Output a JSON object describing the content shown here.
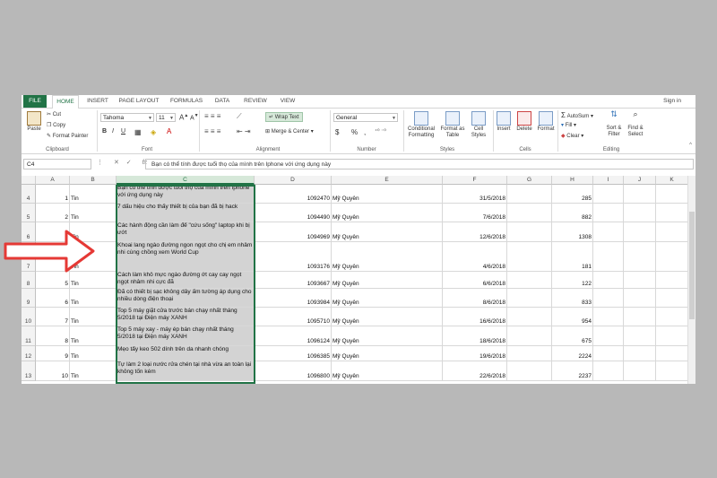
{
  "tabs": [
    "FILE",
    "HOME",
    "INSERT",
    "PAGE LAYOUT",
    "FORMULAS",
    "DATA",
    "REVIEW",
    "VIEW"
  ],
  "sign_in": "Sign in",
  "clipboard": {
    "cut": "Cut",
    "copy": "Copy",
    "paste": "Paste",
    "format_painter": "Format Painter",
    "label": "Clipboard"
  },
  "font": {
    "name": "Tahoma",
    "size": "11",
    "label": "Font",
    "bold": "B",
    "italic": "I",
    "underline": "U"
  },
  "alignment": {
    "wrap_text": "Wrap Text",
    "merge_center": "Merge & Center",
    "label": "Alignment"
  },
  "number": {
    "format": "General",
    "currency": "$",
    "percent": "%",
    "comma": ",",
    "label": "Number"
  },
  "styles": {
    "conditional": "Conditional Formatting",
    "format_table": "Format as Table",
    "cell_styles": "Cell Styles",
    "label": "Styles"
  },
  "cells": {
    "insert": "Insert",
    "delete": "Delete",
    "format": "Format",
    "label": "Cells"
  },
  "editing": {
    "autosum": "AutoSum",
    "fill": "Fill",
    "clear": "Clear",
    "sort": "Sort & Filter",
    "find": "Find & Select",
    "label": "Editing"
  },
  "formula_bar": {
    "name_box": "C4",
    "fx": "fx",
    "content": "Bạn có thể tính được tuổi thọ của mình trên Iphone với ứng dụng này"
  },
  "columns": [
    "A",
    "B",
    "C",
    "D",
    "E",
    "F",
    "G",
    "H",
    "I",
    "J",
    "K"
  ],
  "rows": [
    {
      "row": "4",
      "a": "1",
      "b": "Tin",
      "c": "Bạn có thể tính được tuổi thọ của mình trên Iphone với ứng dụng này",
      "d": "1092470",
      "e": "Mỹ Quyên",
      "f": "31/5/2018",
      "h": "285"
    },
    {
      "row": "5",
      "a": "2",
      "b": "Tin",
      "c": "7 dấu hiệu cho thấy thiết bị của bạn đã bị hack",
      "d": "1094490",
      "e": "Mỹ Quyên",
      "f": "7/6/2018",
      "h": "882"
    },
    {
      "row": "6",
      "a": "3",
      "b": "Tin",
      "c": "Các hành động cần làm để \"cứu sống\" laptop khi bị ướt",
      "d": "1094969",
      "e": "Mỹ Quyên",
      "f": "12/6/2018",
      "h": "1308"
    },
    {
      "row": "7",
      "a": "4",
      "b": "Tin",
      "c": "Khoai lang ngào đường ngon ngọt cho chị em nhâm nhi cùng chồng xem World Cup",
      "d": "1093176",
      "e": "Mỹ Quyên",
      "f": "4/6/2018",
      "h": "181"
    },
    {
      "row": "8",
      "a": "5",
      "b": "Tin",
      "c": "Cách làm khô mực ngào đường ớt cay cay ngọt ngọt nhâm nhi cực đã",
      "d": "1093667",
      "e": "Mỹ Quyên",
      "f": "6/6/2018",
      "h": "122"
    },
    {
      "row": "9",
      "a": "6",
      "b": "Tin",
      "c": "Đã có thiết bị sạc không dây ấm tường áp dụng cho nhiều dòng điện thoại",
      "d": "1093984",
      "e": "Mỹ Quyên",
      "f": "8/6/2018",
      "h": "833"
    },
    {
      "row": "10",
      "a": "7",
      "b": "Tin",
      "c": "Top 5 máy giặt cửa trước bán chạy nhất tháng 5/2018 tại Điện máy XANH",
      "d": "1095710",
      "e": "Mỹ Quyên",
      "f": "16/6/2018",
      "h": "954"
    },
    {
      "row": "11",
      "a": "8",
      "b": "Tin",
      "c": "Top 5 máy xay - máy ép bán chạy nhất tháng 5/2018 tại Điện máy XANH",
      "d": "1096124",
      "e": "Mỹ Quyên",
      "f": "18/6/2018",
      "h": "675"
    },
    {
      "row": "12",
      "a": "9",
      "b": "Tin",
      "c": "Mẹo tẩy keo 502 dính trên da nhanh chóng",
      "d": "1096385",
      "e": "Mỹ Quyên",
      "f": "19/6/2018",
      "h": "2224"
    },
    {
      "row": "13",
      "a": "10",
      "b": "Tin",
      "c": "Tự làm 2 loại nước rửa chén tại nhà vừa an toàn lại không tốn kém",
      "d": "1096800",
      "e": "Mỹ Quyên",
      "f": "22/6/2018",
      "h": "2237"
    }
  ],
  "colors": {
    "accent": "#217346",
    "selection": "#d3d3d3",
    "arrow": "#e53935"
  }
}
